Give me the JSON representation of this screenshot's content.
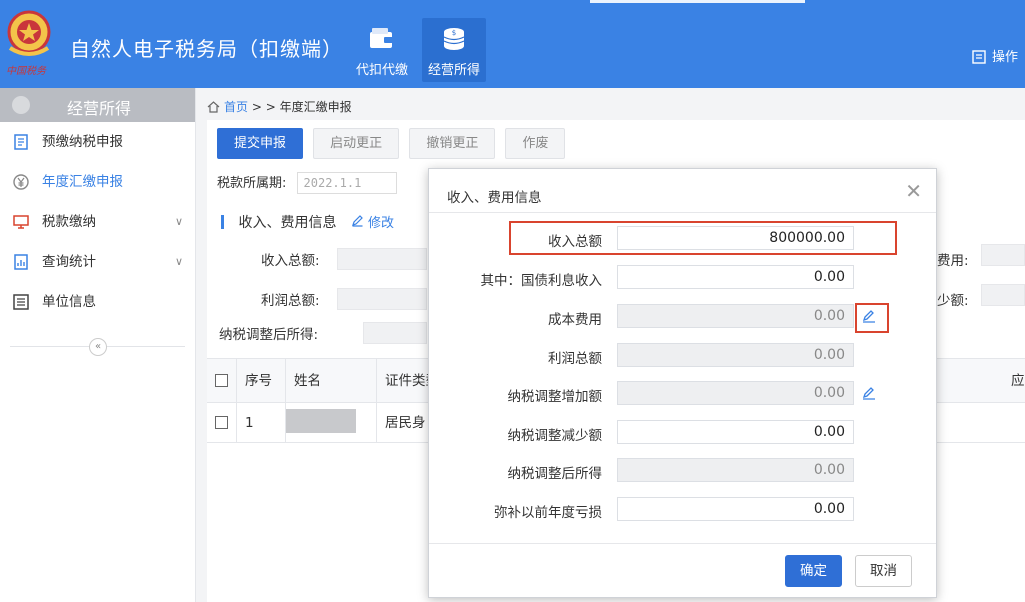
{
  "header": {
    "app_title": "自然人电子税务局（扣缴端）",
    "tabs": [
      {
        "label": "代扣代缴",
        "icon": "wallet-icon",
        "active": false
      },
      {
        "label": "经营所得",
        "icon": "coin-stack-icon",
        "active": true
      }
    ],
    "ops_label": "操作",
    "emblem_text": "中国税务",
    "colors": {
      "bar": "#3a82e4",
      "active_tab": "#2b6fd0"
    }
  },
  "sidebar": {
    "title": "经营所得",
    "items": [
      {
        "label": "预缴纳税申报",
        "icon": "form-icon",
        "active": false,
        "expandable": false
      },
      {
        "label": "年度汇缴申报",
        "icon": "yen-circle-icon",
        "active": true,
        "expandable": false
      },
      {
        "label": "税款缴纳",
        "icon": "monitor-icon",
        "active": false,
        "expandable": true
      },
      {
        "label": "查询统计",
        "icon": "chart-doc-icon",
        "active": false,
        "expandable": true
      },
      {
        "label": "单位信息",
        "icon": "list-icon",
        "active": false,
        "expandable": false
      }
    ],
    "collapse_symbol": "«"
  },
  "breadcrumb": {
    "home": "首页",
    "separator": "> >",
    "current": "年度汇缴申报"
  },
  "toolbar": {
    "submit": "提交申报",
    "start_correction": "启动更正",
    "cancel_correction": "撤销更正",
    "void": "作废"
  },
  "period": {
    "label": "税款所属期:",
    "value": "2022.1.1"
  },
  "section": {
    "title": "收入、费用信息",
    "edit": "修改"
  },
  "form_labels": {
    "total_income": "收入总额:",
    "total_profit": "利润总额:",
    "adjusted_income": "纳税调整后所得:",
    "expense_right": "费用:",
    "decrease_right": "少额:"
  },
  "grid": {
    "headers": [
      "序号",
      "姓名",
      "证件类型",
      "应纳"
    ],
    "rows": [
      {
        "index": "1",
        "id_type": "居民身"
      }
    ]
  },
  "modal": {
    "title": "收入、费用信息",
    "close": "✕",
    "fields": [
      {
        "label": "收入总额",
        "value": "800000.00",
        "readonly": false,
        "editable_icon": false
      },
      {
        "label": "其中：国债利息收入",
        "value": "0.00",
        "readonly": false,
        "editable_icon": false
      },
      {
        "label": "成本费用",
        "value": "0.00",
        "readonly": true,
        "editable_icon": true
      },
      {
        "label": "利润总额",
        "value": "0.00",
        "readonly": true,
        "editable_icon": false
      },
      {
        "label": "纳税调整增加额",
        "value": "0.00",
        "readonly": true,
        "editable_icon": true
      },
      {
        "label": "纳税调整减少额",
        "value": "0.00",
        "readonly": false,
        "editable_icon": false
      },
      {
        "label": "纳税调整后所得",
        "value": "0.00",
        "readonly": true,
        "editable_icon": false
      },
      {
        "label": "弥补以前年度亏损",
        "value": "0.00",
        "readonly": false,
        "editable_icon": false
      }
    ],
    "confirm": "确定",
    "cancel": "取消",
    "highlight_color": "#d9442e"
  }
}
